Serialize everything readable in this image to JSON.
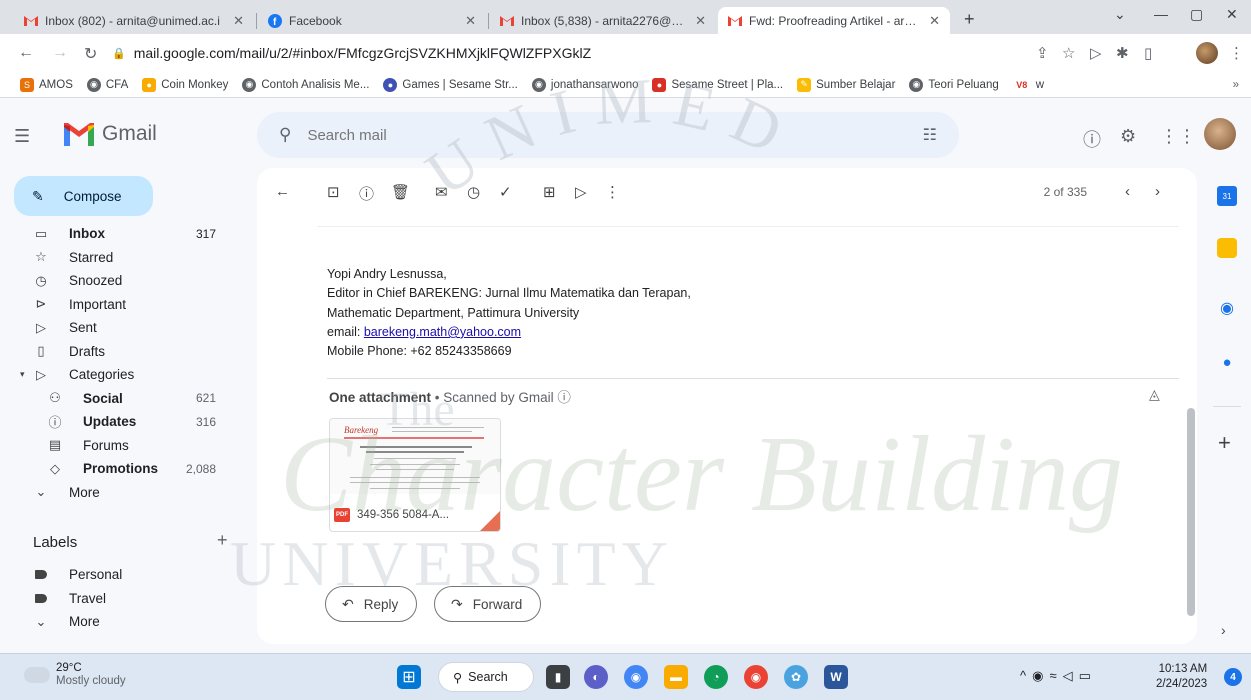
{
  "browser": {
    "tabs": [
      {
        "title": "Inbox (802) - arnita@unimed.ac.i",
        "active": false
      },
      {
        "title": "Facebook",
        "active": false
      },
      {
        "title": "Inbox (5,838) - arnita2276@gmai",
        "active": false
      },
      {
        "title": "Fwd: Proofreading Artikel - arnita",
        "active": true
      }
    ],
    "url": "mail.google.com/mail/u/2/#inbox/FMfcgzGrcjSVZKHMXjklFQWlZFPXGklZ",
    "bookmarks": [
      "AMOS",
      "CFA",
      "Coin Monkey",
      "Contoh Analisis Me...",
      "Games | Sesame Str...",
      "jonathansarwono",
      "Sesame Street | Pla...",
      "Sumber Belajar",
      "Teori Peluang",
      "w"
    ]
  },
  "gmail": {
    "app_name": "Gmail",
    "search_placeholder": "Search mail",
    "compose_label": "Compose",
    "nav": [
      {
        "label": "Inbox",
        "count": "317",
        "icon": "inbox-icon"
      },
      {
        "label": "Starred",
        "count": "",
        "icon": "star-icon"
      },
      {
        "label": "Snoozed",
        "count": "",
        "icon": "clock-icon"
      },
      {
        "label": "Important",
        "count": "",
        "icon": "important-icon"
      },
      {
        "label": "Sent",
        "count": "",
        "icon": "send-icon"
      },
      {
        "label": "Drafts",
        "count": "",
        "icon": "draft-icon"
      },
      {
        "label": "Categories",
        "count": "",
        "icon": "label-icon"
      },
      {
        "label": "Social",
        "count": "621",
        "icon": "people-icon"
      },
      {
        "label": "Updates",
        "count": "316",
        "icon": "info-icon"
      },
      {
        "label": "Forums",
        "count": "",
        "icon": "forum-icon"
      },
      {
        "label": "Promotions",
        "count": "2,088",
        "icon": "tag-icon"
      },
      {
        "label": "More",
        "count": "",
        "icon": "chevron-down-icon"
      }
    ],
    "labels_heading": "Labels",
    "labels": [
      {
        "label": "Personal"
      },
      {
        "label": "Travel"
      },
      {
        "label": "More"
      }
    ]
  },
  "message": {
    "pager": "2 of 335",
    "signature": {
      "name": "Yopi Andry Lesnussa,",
      "title": "Editor in Chief BAREKENG: Jurnal Ilmu Matematika dan Terapan,",
      "dept": "Mathematic Department, Pattimura University",
      "email_label": "email: ",
      "email": "barekeng.math@yahoo.com",
      "phone": "Mobile Phone: +62 85243358669"
    },
    "attachment_heading": "One attachment",
    "scanned": "Scanned by Gmail",
    "attachment_name": "349-356 5084-A...",
    "attachment_logo": "Barekeng",
    "reply_label": "Reply",
    "forward_label": "Forward"
  },
  "watermark": {
    "arc_text": "UNIMED",
    "left_text": "The",
    "script_text": "Character Building",
    "bottom_text": "UNIVERSITY"
  },
  "taskbar": {
    "temperature": "29°C",
    "weather": "Mostly cloudy",
    "search_label": "Search",
    "time": "10:13 AM",
    "date": "2/24/2023",
    "notifications": "4"
  }
}
